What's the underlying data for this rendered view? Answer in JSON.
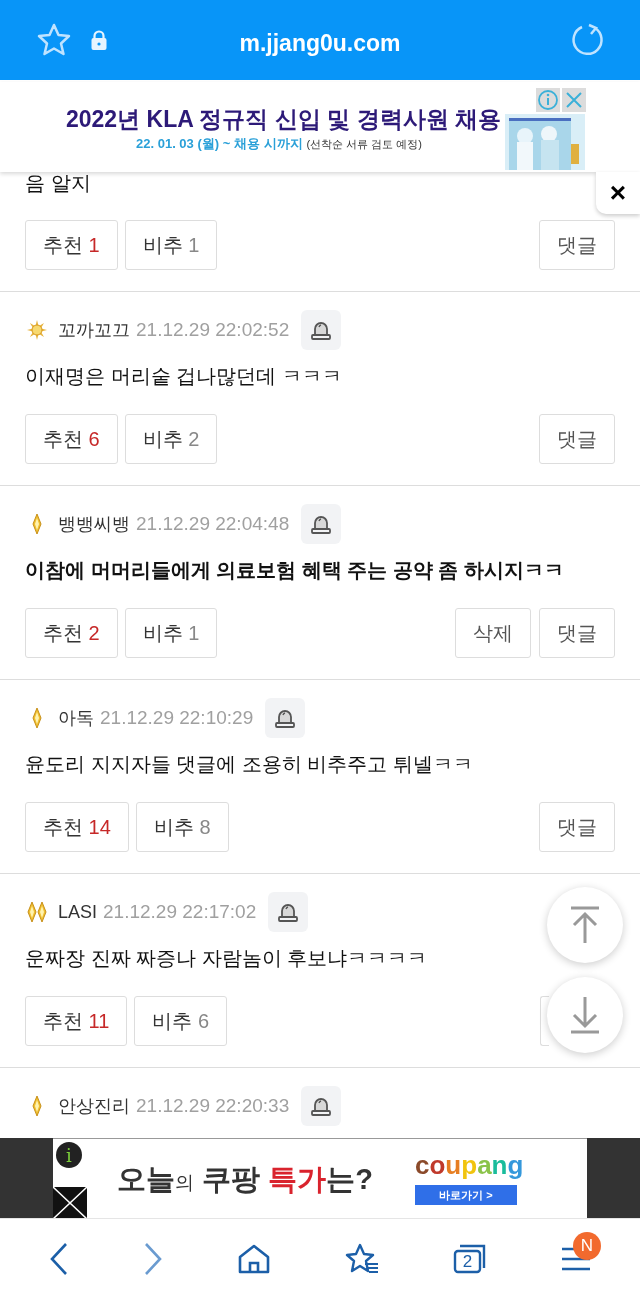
{
  "browser": {
    "url": "m.jjang0u.com"
  },
  "top_ad": {
    "headline": "2022년 KLA 정규직 신입 및 경력사원 채용",
    "date_line": "22. 01. 03 (월) ~ 채용 시까지",
    "note": "(선착순 서류 검토 예정)"
  },
  "close_tab": {
    "label": "×"
  },
  "comments": [
    {
      "partial": true,
      "text": "음 알지",
      "up_label": "추천",
      "up": "1",
      "down_label": "비추",
      "down": "1",
      "actions": [
        "댓글"
      ]
    },
    {
      "rank_icon": {
        "kind": "sun"
      },
      "author": "꼬까꼬끄",
      "time": "21.12.29 22:02:52",
      "text": "이재명은 머리숱 겁나많던데 ㅋㅋㅋ",
      "up_label": "추천",
      "up": "6",
      "down_label": "비추",
      "down": "2",
      "actions": [
        "댓글"
      ]
    },
    {
      "rank_icon": {
        "kind": "diamond"
      },
      "author": "뱅뱅씨뱅",
      "time": "21.12.29 22:04:48",
      "text": "이참에 머머리들에게 의료보험 혜택 주는 공약 좀 하시지ㅋㅋ",
      "bold": true,
      "up_label": "추천",
      "up": "2",
      "down_label": "비추",
      "down": "1",
      "actions": [
        "삭제",
        "댓글"
      ]
    },
    {
      "rank_icon": {
        "kind": "diamond"
      },
      "author": "아독",
      "time": "21.12.29 22:10:29",
      "text": "윤도리 지지자들 댓글에 조용히 비추주고 튀넬ㅋㅋ",
      "up_label": "추천",
      "up": "14",
      "down_label": "비추",
      "down": "8",
      "actions": [
        "댓글"
      ]
    },
    {
      "rank_icon": {
        "kind": "double-diamond"
      },
      "author": "LASI",
      "time": "21.12.29 22:17:02",
      "text": "운짜장 진짜 짜증나 자람놈이 후보냐ㅋㅋㅋㅋ",
      "up_label": "추천",
      "up": "11",
      "down_label": "비추",
      "down": "6",
      "covered_action": true
    },
    {
      "rank_icon": {
        "kind": "diamond"
      },
      "author": "안상진리",
      "time": "21.12.29 22:20:33",
      "cut": true
    }
  ],
  "bottom_ad": {
    "info": "i",
    "headline": [
      {
        "kind": "plain",
        "text": "오늘"
      },
      {
        "kind": "small",
        "text": "의"
      },
      {
        "kind": "plain",
        "text": " 쿠팡 "
      },
      {
        "kind": "accent",
        "text": "특가"
      },
      {
        "kind": "plain",
        "text": "는?"
      }
    ],
    "brand": "coupang",
    "cta": "바로가기 >"
  },
  "nav": {
    "tabs_count": "2",
    "menu_badge": "N"
  }
}
